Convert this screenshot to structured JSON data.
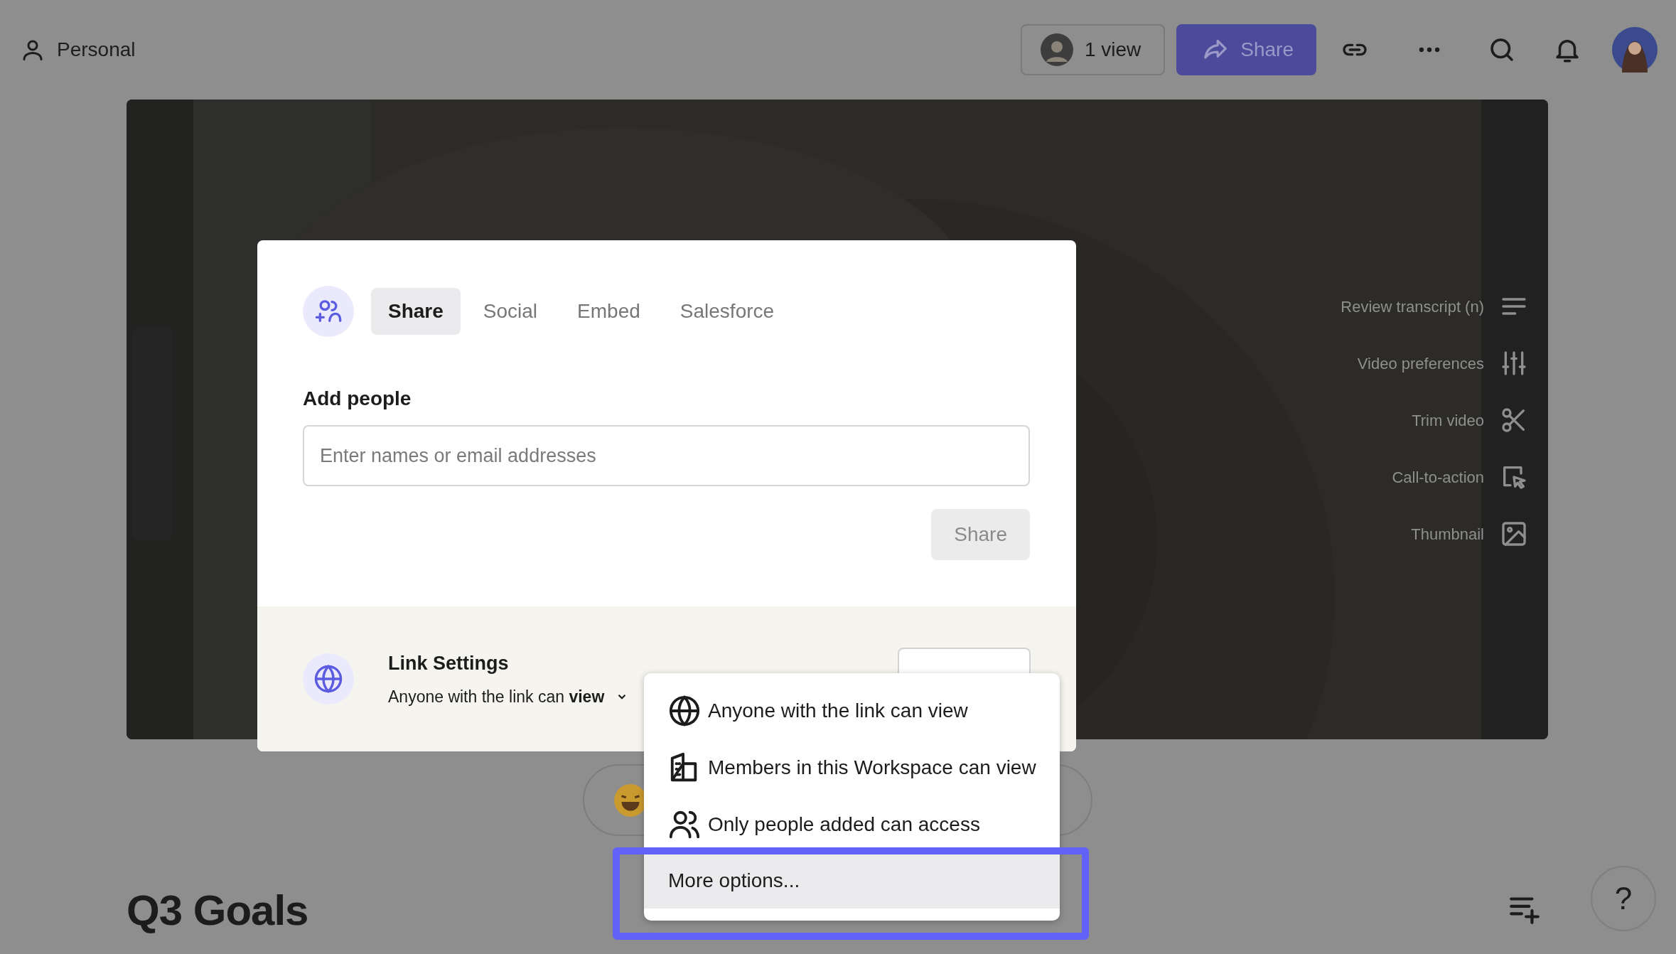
{
  "header": {
    "workspace": "Personal",
    "views": "1 view",
    "share_button": "Share"
  },
  "video_actions": [
    {
      "label": "Review transcript (n)",
      "kind": "transcript"
    },
    {
      "label": "Video preferences",
      "kind": "preferences"
    },
    {
      "label": "Trim video",
      "kind": "trim"
    },
    {
      "label": "Call-to-action",
      "kind": "cta"
    },
    {
      "label": "Thumbnail",
      "kind": "thumbnail"
    }
  ],
  "share_modal": {
    "tabs": [
      {
        "label": "Share",
        "selected": true
      },
      {
        "label": "Social",
        "selected": false
      },
      {
        "label": "Embed",
        "selected": false
      },
      {
        "label": "Salesforce",
        "selected": false
      }
    ],
    "add_people_label": "Add people",
    "placeholder": "Enter names or email addresses",
    "share_button": {
      "label": "Share",
      "disabled": true
    },
    "link_settings": {
      "title": "Link Settings",
      "access": "Anyone with the link can **view**"
    }
  },
  "access_menu": [
    {
      "label": "Anyone with the link can view",
      "kind": "globe",
      "selected": false
    },
    {
      "label": "Members in this Workspace can view",
      "kind": "building",
      "selected": false
    },
    {
      "label": "Only people added can access",
      "kind": "people",
      "selected": false
    },
    {
      "label": "More options...",
      "kind": "more",
      "selected": true
    }
  ],
  "title": "Q3 Goals",
  "help_button": "?"
}
